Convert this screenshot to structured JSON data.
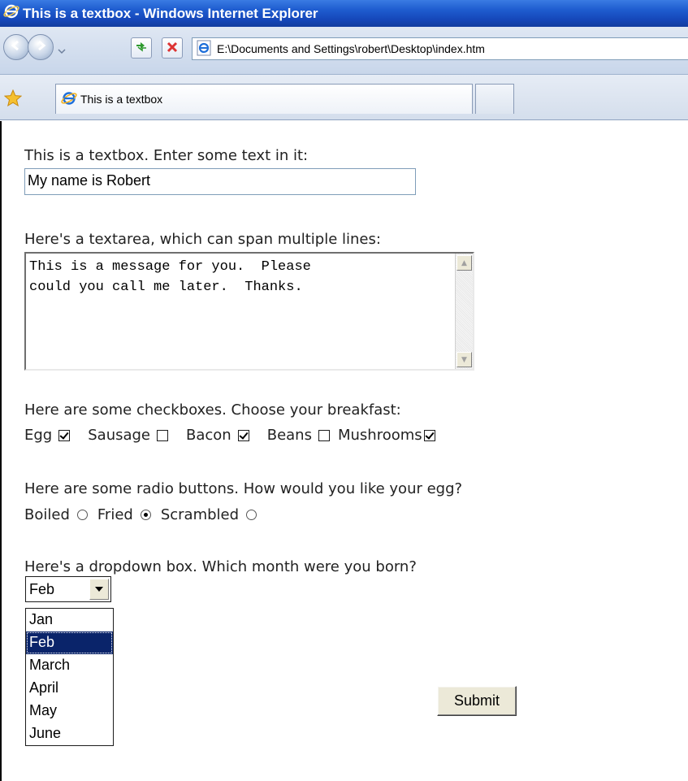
{
  "window": {
    "title": "This is a textbox - Windows Internet Explorer"
  },
  "address_bar": {
    "url": "E:\\Documents and Settings\\robert\\Desktop\\index.htm"
  },
  "tabs": [
    {
      "label": "This is a textbox",
      "active": true
    }
  ],
  "form": {
    "textbox_label": "This is a textbox.  Enter some text in it:",
    "textbox_value": "My name is Robert",
    "textarea_label": "Here's a textarea, which can span multiple lines:",
    "textarea_value": "This is a message for you.  Please\ncould you call me later.  Thanks.",
    "checkbox_label": "Here are some checkboxes.  Choose your breakfast:",
    "checkboxes": [
      {
        "label": "Egg",
        "checked": true
      },
      {
        "label": "Sausage",
        "checked": false
      },
      {
        "label": "Bacon",
        "checked": true
      },
      {
        "label": "Beans",
        "checked": false
      },
      {
        "label": "Mushrooms",
        "checked": true
      }
    ],
    "radio_label": "Here are some radio buttons.  How would you like your egg?",
    "radios": [
      {
        "label": "Boiled",
        "selected": false
      },
      {
        "label": "Fried",
        "selected": true
      },
      {
        "label": "Scrambled",
        "selected": false
      }
    ],
    "dropdown_label": "Here's a dropdown box.  Which month were you born?",
    "dropdown_value": "Feb",
    "dropdown_options": [
      "Jan",
      "Feb",
      "March",
      "April",
      "May",
      "June"
    ],
    "dropdown_highlighted": "Feb",
    "submit_label": "Submit"
  },
  "colors": {
    "titlebar": "#1f5dd0",
    "selection": "#0a246a",
    "button_face": "#ece9d8"
  }
}
